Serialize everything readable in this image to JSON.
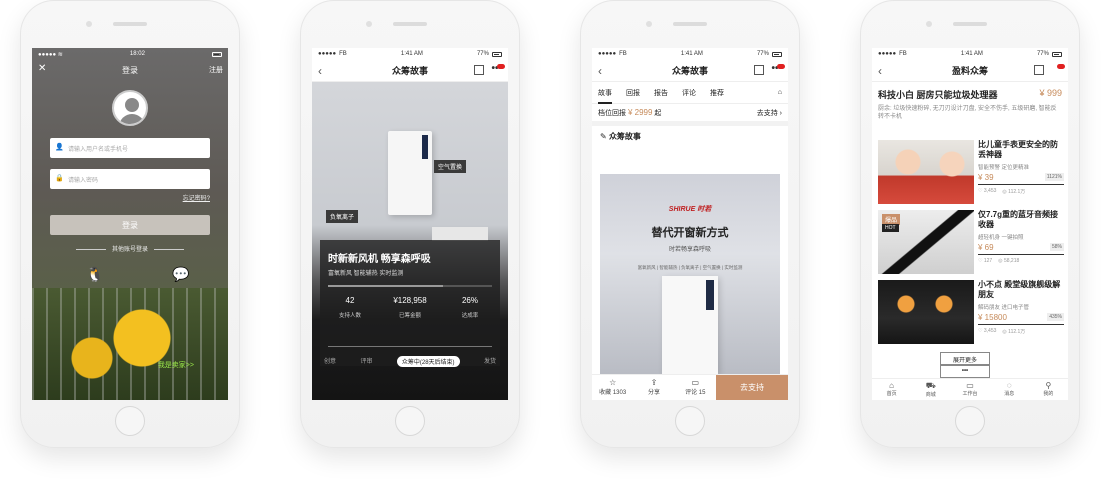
{
  "status": {
    "login": {
      "time": "18:02"
    },
    "common": {
      "carrier": "FB",
      "time": "1:41 AM",
      "battery": "77%"
    }
  },
  "login": {
    "title": "登录",
    "register": "注册",
    "username_placeholder": "请输入用户名或手机号",
    "password_placeholder": "请输入密码",
    "forgot": "忘记密码?",
    "login_button": "登录",
    "other_login": "其他账号登录",
    "seller": "我是卖家>>"
  },
  "story": {
    "title": "众筹故事",
    "tag_right": "空气置换",
    "tag_left": "负氧离子",
    "headline": "时新新风机 畅享森呼吸",
    "subline": "富氧新风 智能辅热 实时监测",
    "stats": [
      {
        "value": "42",
        "label": "支持人数"
      },
      {
        "value": "¥128,958",
        "label": "已筹金额"
      },
      {
        "value": "26%",
        "label": "达成率"
      }
    ],
    "phases": {
      "p1": "创意",
      "p2": "评审",
      "current": "众筹中(28天后结束)",
      "p3": "发货"
    }
  },
  "detail": {
    "title": "众筹故事",
    "tabs": [
      "故事",
      "回报",
      "报告",
      "评论",
      "推荐"
    ],
    "tier_label": "档位回报",
    "tier_price": "¥ 2999",
    "tier_suffix": "起",
    "go_support": "去支持",
    "section": "众筹故事",
    "brand": "SHIRUE 时若",
    "poster_title": "替代开窗新方式",
    "poster_sub": "时若畅享森呼吸",
    "poster_features": "富氧新风 | 智能辅热 | 负氧离子 | 空气置换 | 实时监测",
    "bottom": {
      "collect": "收藏 1303",
      "share": "分享",
      "comment": "评论 15",
      "support": "去支持"
    }
  },
  "earn": {
    "title": "盈料众筹",
    "head_title": "科技小白 厨房只能垃圾处理器",
    "head_price": "¥ 999",
    "head_desc": "厨余: 垃圾快速粉碎, 无刀刃设计刀盘, 安全不伤手, 五级研磨, 智能反转不卡机",
    "items": [
      {
        "name": "比儿童手表更安全的防丢神器",
        "sub": "智能预警 定位更精准",
        "price": "¥ 39",
        "pct": "1121%",
        "likes": "3,453",
        "views": "112.1万"
      },
      {
        "name": "仅7.7g重的蓝牙音频接收器",
        "sub": "超轻机身 一键拍照",
        "price": "¥ 69",
        "pct": "58%",
        "likes": "127",
        "views": "58,218",
        "badge1": "爆品",
        "badge2": "HOT"
      },
      {
        "name": "小不点 殿堂级旗舰级解朋友",
        "sub": "解码朋友 进口电子管",
        "price": "¥ 15800",
        "pct": "435%",
        "likes": "3,453",
        "views": "112.1万"
      }
    ],
    "more": "展开更多",
    "tabbar": [
      "首页",
      "商城",
      "工作台",
      "消息",
      "我的"
    ]
  }
}
